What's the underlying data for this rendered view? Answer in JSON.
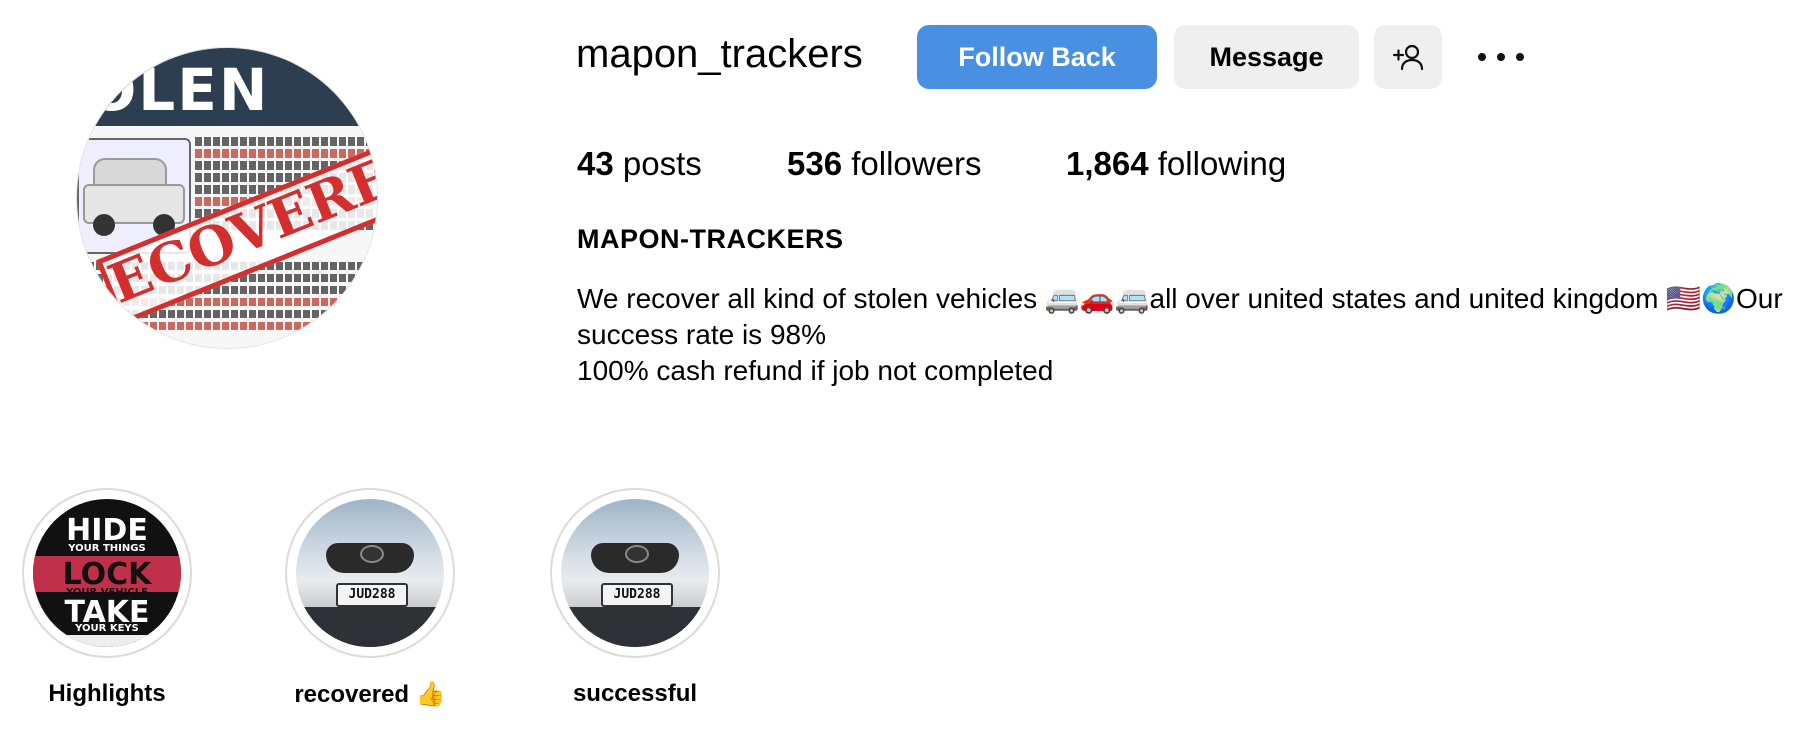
{
  "profile": {
    "username": "mapon_trackers",
    "avatar_alt": "",
    "avatar_text": {
      "title": "OLEN",
      "stamp": "ECOVERED"
    }
  },
  "actions": {
    "follow_back": "Follow Back",
    "message": "Message",
    "add_user_icon": "add-user-icon",
    "more_icon": "more-options-icon"
  },
  "stats": {
    "posts_count": "43",
    "posts_label": "posts",
    "followers_count": "536",
    "followers_label": "followers",
    "following_count": "1,864",
    "following_label": "following"
  },
  "bio": {
    "full_name": "MAPON-TRACKERS",
    "line1": "We recover all kind of stolen vehicles 🚐🚗🚐all over united states and united kingdom 🇺🇸🌍Our",
    "line2": "success rate is 98%",
    "line3": "100% cash refund if job not completed"
  },
  "highlights": [
    {
      "label": "Highlights",
      "image_text": [
        "HIDE",
        "YOUR THINGS",
        "LOCK",
        "YOUR VEHICLE",
        "TAKE",
        "YOUR KEYS"
      ]
    },
    {
      "label": "recovered 👍",
      "plate": "JUD288"
    },
    {
      "label": "successful",
      "plate": "JUD288"
    }
  ],
  "colors": {
    "primary_button": "#4a90e2",
    "secondary_button": "#efefef",
    "text": "#000000",
    "stamp_red": "#d32f2f"
  }
}
